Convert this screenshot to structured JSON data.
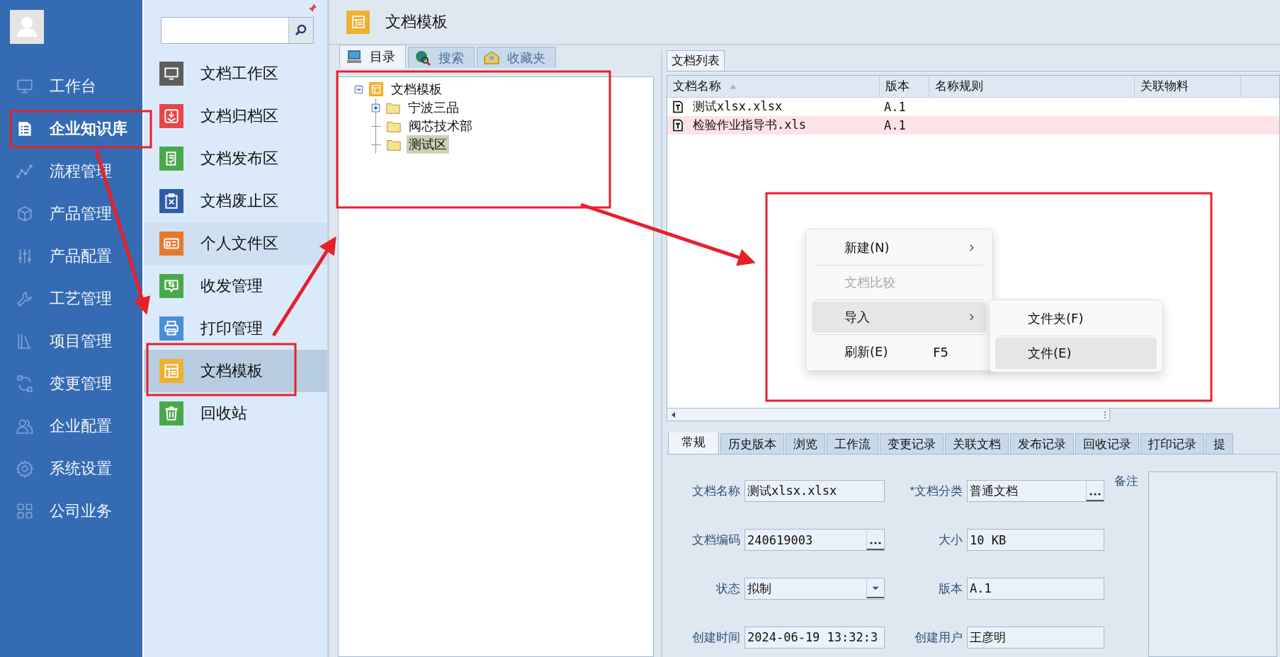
{
  "nav": {
    "items": [
      {
        "label": "工作台",
        "selected": false
      },
      {
        "label": "企业知识库",
        "selected": true
      },
      {
        "label": "流程管理",
        "selected": false
      },
      {
        "label": "产品管理",
        "selected": false
      },
      {
        "label": "产品配置",
        "selected": false
      },
      {
        "label": "工艺管理",
        "selected": false
      },
      {
        "label": "项目管理",
        "selected": false
      },
      {
        "label": "变更管理",
        "selected": false
      },
      {
        "label": "企业配置",
        "selected": false
      },
      {
        "label": "系统设置",
        "selected": false
      },
      {
        "label": "公司业务",
        "selected": false
      }
    ]
  },
  "subnav": {
    "items": [
      {
        "label": "文档工作区",
        "color": "#5e5e5e",
        "selected": false,
        "hovered": false
      },
      {
        "label": "文档归档区",
        "color": "#e8464a",
        "selected": false,
        "hovered": false
      },
      {
        "label": "文档发布区",
        "color": "#4aa84c",
        "selected": false,
        "hovered": false
      },
      {
        "label": "文档废止区",
        "color": "#2e5ca8",
        "selected": false,
        "hovered": false
      },
      {
        "label": "个人文件区",
        "color": "#e6782e",
        "selected": false,
        "hovered": true
      },
      {
        "label": "收发管理",
        "color": "#4aa84c",
        "selected": false,
        "hovered": false
      },
      {
        "label": "打印管理",
        "color": "#4a8ed4",
        "selected": false,
        "hovered": false
      },
      {
        "label": "文档模板",
        "color": "#f0b030",
        "selected": true,
        "hovered": false
      },
      {
        "label": "回收站",
        "color": "#4aa84c",
        "selected": false,
        "hovered": false
      }
    ]
  },
  "page_header": {
    "title": "文档模板"
  },
  "tree_pane": {
    "tabs": [
      {
        "label": "目录",
        "selected": true
      },
      {
        "label": "搜索",
        "selected": false
      },
      {
        "label": "收藏夹",
        "selected": false
      }
    ],
    "tree": [
      {
        "label": "文档模板",
        "kind": "root",
        "expanded": true,
        "selected": false,
        "children": [
          {
            "label": "宁波三品",
            "kind": "folder",
            "expanded": false,
            "selected": false
          },
          {
            "label": "阀芯技术部",
            "kind": "folder",
            "selected": false
          },
          {
            "label": "测试区",
            "kind": "folder",
            "selected": true
          }
        ]
      }
    ]
  },
  "list_pane": {
    "tabs": [
      {
        "label": "文档列表",
        "selected": true
      }
    ],
    "table": {
      "columns": [
        {
          "label": "文档名称",
          "sorted": true
        },
        {
          "label": "版本"
        },
        {
          "label": "名称规则"
        },
        {
          "label": "关联物料"
        }
      ],
      "rows": [
        {
          "name": "测试xlsx.xlsx",
          "version": "A.1",
          "marked": false
        },
        {
          "name": "检验作业指导书.xls",
          "version": "A.1",
          "marked": true
        }
      ]
    }
  },
  "detail": {
    "tabs": [
      {
        "label": "常规",
        "selected": true
      },
      {
        "label": "历史版本",
        "selected": false
      },
      {
        "label": "浏览",
        "selected": false
      },
      {
        "label": "工作流",
        "selected": false
      },
      {
        "label": "变更记录",
        "selected": false
      },
      {
        "label": "关联文档",
        "selected": false
      },
      {
        "label": "发布记录",
        "selected": false
      },
      {
        "label": "回收记录",
        "selected": false
      },
      {
        "label": "打印记录",
        "selected": false
      },
      {
        "label": "提",
        "selected": false
      }
    ],
    "fields": [
      {
        "label": "文档名称",
        "value": "测试xlsx.xlsx",
        "kind": "text"
      },
      {
        "label": "*文档分类",
        "value": "普通文档",
        "kind": "picker"
      },
      {
        "label": "文档编码",
        "value": "240619003",
        "kind": "picker"
      },
      {
        "label": "大小",
        "value": "10 KB",
        "kind": "text"
      },
      {
        "label": "状态",
        "value": "拟制",
        "kind": "dropdown"
      },
      {
        "label": "版本",
        "value": "A.1",
        "kind": "text"
      },
      {
        "label": "创建时间",
        "value": "2024-06-19 13:32:3",
        "kind": "text"
      },
      {
        "label": "创建用户",
        "value": "王彦明",
        "kind": "text"
      }
    ],
    "remarks": {
      "label": "备注"
    }
  },
  "context_menu": {
    "items": [
      {
        "label": "新建(N)",
        "submenu": true,
        "disabled": false,
        "selected": false
      },
      {
        "label": "文档比较",
        "submenu": false,
        "disabled": true,
        "selected": false
      },
      {
        "label": "导入",
        "submenu": true,
        "disabled": false,
        "selected": true
      },
      {
        "label": "刷新(E)",
        "submenu": false,
        "disabled": false,
        "selected": false,
        "shortcut": "F5"
      }
    ],
    "submenu": {
      "items": [
        {
          "label": "文件夹(F)",
          "selected": false
        },
        {
          "label": "文件(E)",
          "selected": true
        }
      ]
    }
  }
}
